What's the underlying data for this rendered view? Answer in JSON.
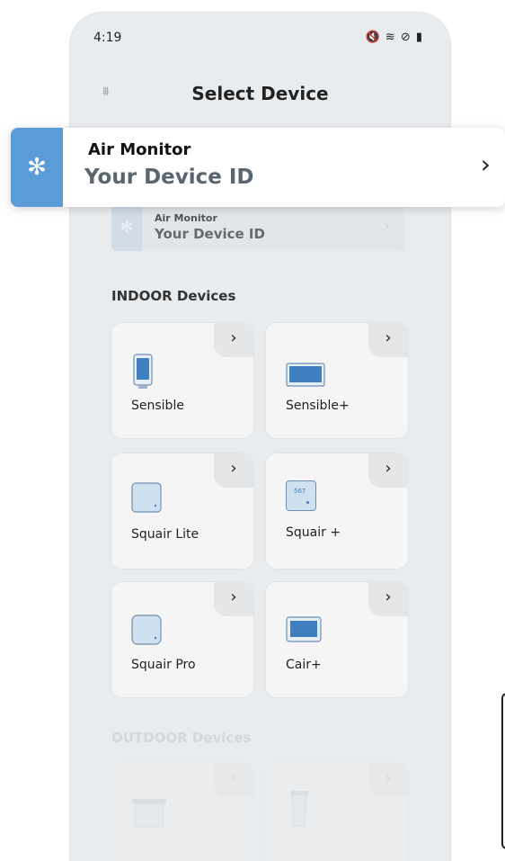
{
  "status_bar": {
    "time": "4:19",
    "icons": "🔇 ≋ ⊘ ▮"
  },
  "header": {
    "title": "Select Device",
    "logo": "⩩"
  },
  "device_row": {
    "name": "Air Monitor",
    "id": "Your Device ID",
    "icon": "bluetooth-icon"
  },
  "overlay": {
    "name": "Air Monitor",
    "id": "Your Device ID",
    "icon": "bluetooth-icon"
  },
  "sections": {
    "indoor": "INDOOR Devices",
    "outdoor": "OUTDOOR Devices"
  },
  "indoor_devices": [
    {
      "label": "Sensible"
    },
    {
      "label": "Sensible+"
    },
    {
      "label": "Squair Lite"
    },
    {
      "label": "Squair +",
      "screen_text": "567"
    },
    {
      "label": "Squair Pro"
    },
    {
      "label": "Cair+"
    }
  ],
  "colors": {
    "accent": "#5b9bd7",
    "background": "#e9ecef",
    "card": "#f5f5f5"
  }
}
